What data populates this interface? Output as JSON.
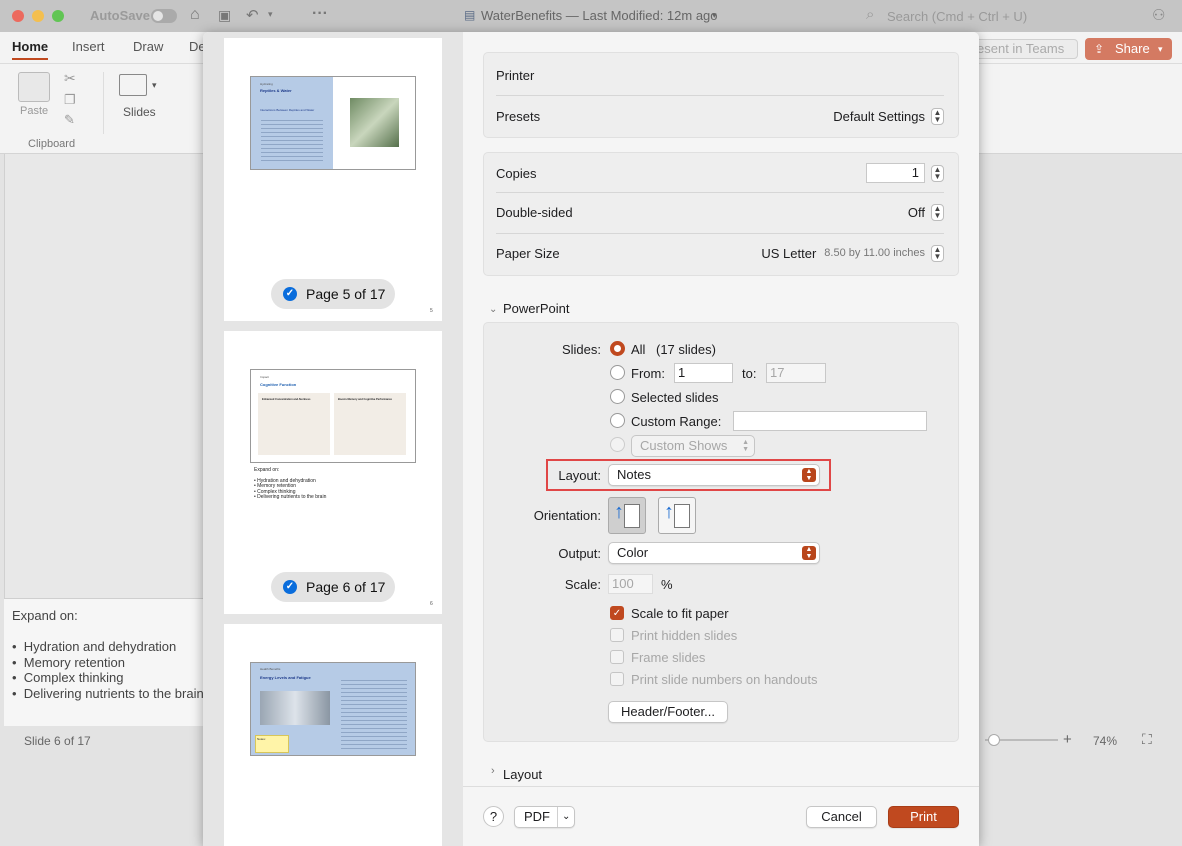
{
  "titlebar": {
    "autosave_label": "AutoSave",
    "document_title": "WaterBenefits — Last Modified: 12m ago",
    "search_placeholder": "Search (Cmd + Ctrl + U)"
  },
  "ribbon": {
    "tabs": [
      "Home",
      "Insert",
      "Draw",
      "De"
    ],
    "paste_label": "Paste",
    "slides_label": "Slides",
    "clipboard_group": "Clipboard",
    "present_in_teams": "esent in Teams",
    "share_label": "Share"
  },
  "notes_pane": {
    "heading": "Expand on:",
    "items": [
      "Hydration and dehydration",
      "Memory retention",
      "Complex thinking",
      "Delivering nutrients to the brain"
    ]
  },
  "statusbar": {
    "slide_indicator": "Slide 6 of 17",
    "zoom": "74%"
  },
  "preview": {
    "pages": [
      {
        "badge": "Page 5 of 17",
        "number": "5",
        "slide_title": "Reptiles & Water",
        "slide_section": "Hydrating",
        "slide_subheading": "Interactions Between Reptiles and Water"
      },
      {
        "badge": "Page 6 of 17",
        "number": "6",
        "slide_title": "Cognitive Function",
        "slide_section": "Impact",
        "col1_heading": "Enhanced Concentration and Alertness",
        "col2_heading": "Boosts Memory and Cognitive Performance",
        "notes_heading": "Expand on:",
        "notes_items": [
          "Hydration and dehydration",
          "Memory retention",
          "Complex thinking",
          "Delivering nutrients to the brain"
        ]
      },
      {
        "slide_title": "Energy Levels and Fatigue",
        "slide_section": "Health Benefits",
        "note_label": "Notes:"
      }
    ]
  },
  "print": {
    "printer_label": "Printer",
    "presets_label": "Presets",
    "presets_value": "Default Settings",
    "copies_label": "Copies",
    "copies_value": "1",
    "double_sided_label": "Double-sided",
    "double_sided_value": "Off",
    "paper_size_label": "Paper Size",
    "paper_size_value": "US Letter",
    "paper_size_detail": "8.50 by 11.00 inches",
    "section_powerpoint": "PowerPoint",
    "slides_label": "Slides:",
    "opt_all": "All",
    "opt_all_count": "(17 slides)",
    "opt_from": "From:",
    "from_value": "1",
    "to_label": "to:",
    "to_placeholder": "17",
    "opt_selected": "Selected slides",
    "opt_custom_range": "Custom Range:",
    "opt_custom_shows": "Custom Shows",
    "layout_label": "Layout:",
    "layout_value": "Notes",
    "orientation_label": "Orientation:",
    "output_label": "Output:",
    "output_value": "Color",
    "scale_label": "Scale:",
    "scale_value": "100",
    "scale_unit": "%",
    "cb_scale_fit": "Scale to fit paper",
    "cb_hidden": "Print hidden slides",
    "cb_frame": "Frame slides",
    "cb_numbers": "Print slide numbers on handouts",
    "header_footer_btn": "Header/Footer...",
    "section_layout": "Layout",
    "help": "?",
    "pdf": "PDF",
    "cancel": "Cancel",
    "print": "Print"
  },
  "colors": {
    "accent": "#c0491f",
    "highlight_box": "#e04646",
    "check_blue": "#0a6ddc",
    "share_button": "#c8553a"
  }
}
